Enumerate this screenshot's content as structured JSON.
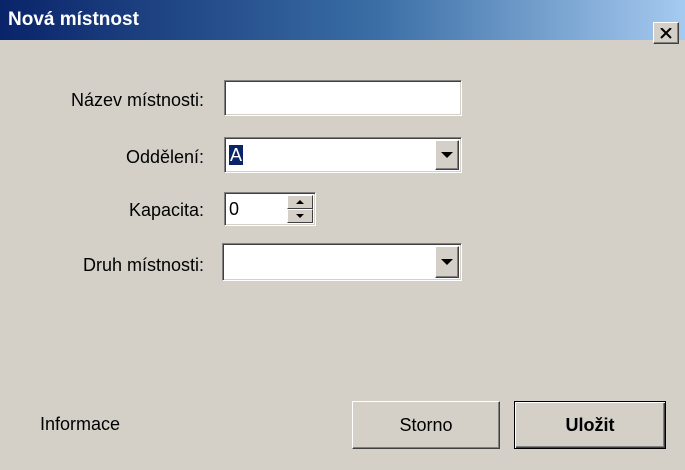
{
  "window": {
    "title": "Nová místnost",
    "close_label": "×"
  },
  "form": {
    "name_label": "Název místnosti:",
    "name_value": "",
    "department_label": "Oddělení:",
    "department_value": "A",
    "capacity_label": "Kapacita:",
    "capacity_value": "0",
    "room_type_label": "Druh místnosti:",
    "room_type_value": ""
  },
  "footer": {
    "info_text": "Informace",
    "cancel_label": "Storno",
    "save_label": "Uložit"
  },
  "colors": {
    "title_gradient_start": "#0a246a",
    "title_gradient_end": "#a6caf0",
    "dialog_background": "#d4d0c8",
    "selection": "#0a246a"
  },
  "icons": {
    "close": "close-icon",
    "dropdown": "chevron-down-icon",
    "spin_up": "spin-up-icon",
    "spin_down": "spin-down-icon"
  }
}
